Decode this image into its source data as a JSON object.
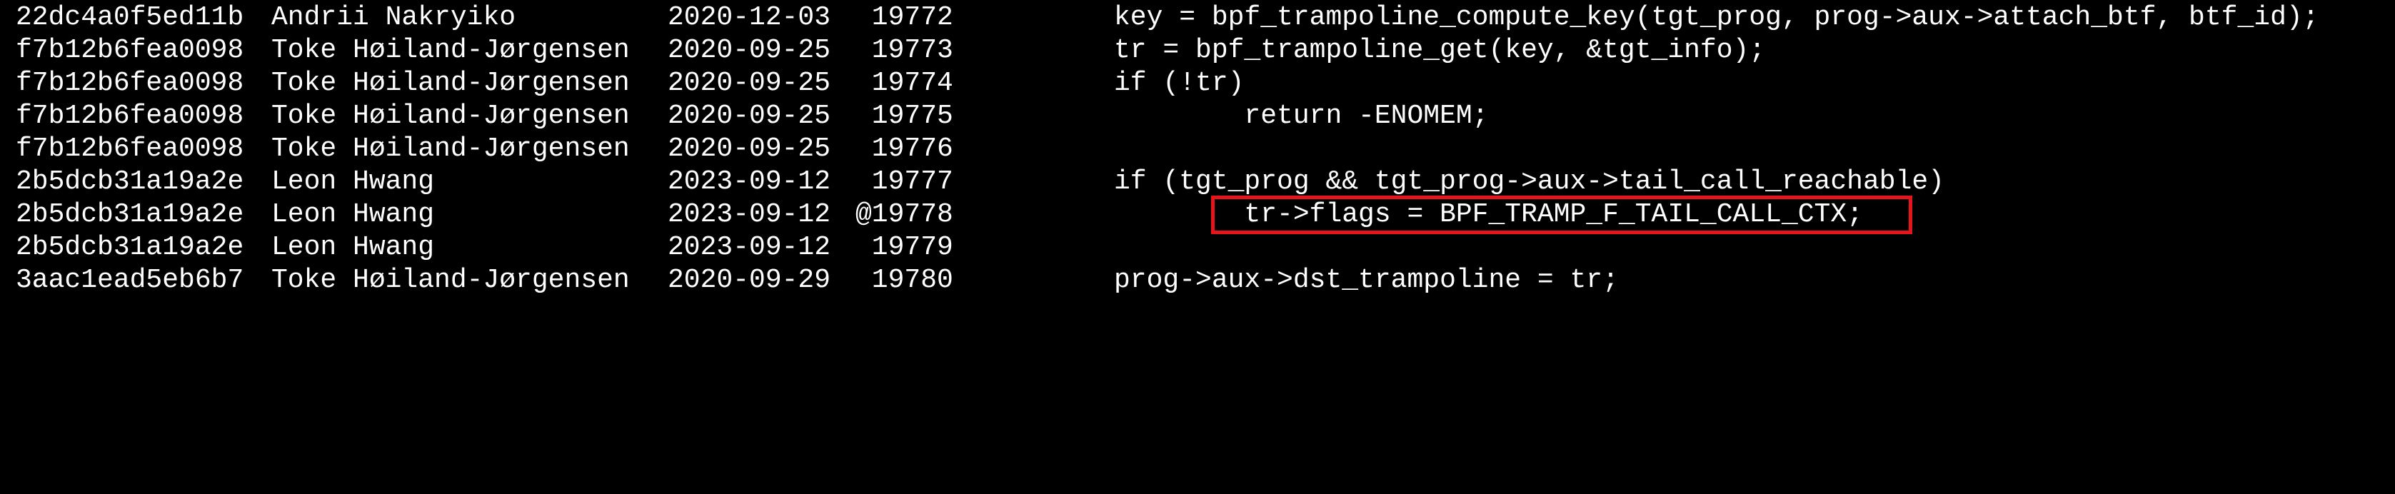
{
  "terminal": {
    "background": "#000000",
    "foreground": "#ffffff",
    "highlight_color": "#e8141b",
    "rows": [
      {
        "hash": "22dc4a0f5ed11b",
        "author": "Andrii Nakryiko",
        "date": "2020-12-03",
        "line": " 19772",
        "code": "key = bpf_trampoline_compute_key(tgt_prog, prog->aux->attach_btf, btf_id);"
      },
      {
        "hash": "f7b12b6fea0098",
        "author": "Toke Høiland-Jørgensen",
        "date": "2020-09-25",
        "line": " 19773",
        "code": "tr = bpf_trampoline_get(key, &tgt_info);"
      },
      {
        "hash": "f7b12b6fea0098",
        "author": "Toke Høiland-Jørgensen",
        "date": "2020-09-25",
        "line": " 19774",
        "code": "if (!tr)"
      },
      {
        "hash": "f7b12b6fea0098",
        "author": "Toke Høiland-Jørgensen",
        "date": "2020-09-25",
        "line": " 19775",
        "code": "        return -ENOMEM;"
      },
      {
        "hash": "f7b12b6fea0098",
        "author": "Toke Høiland-Jørgensen",
        "date": "2020-09-25",
        "line": " 19776",
        "code": ""
      },
      {
        "hash": "2b5dcb31a19a2e",
        "author": "Leon Hwang",
        "date": "2023-09-12",
        "line": " 19777",
        "code": "if (tgt_prog && tgt_prog->aux->tail_call_reachable)"
      },
      {
        "hash": "2b5dcb31a19a2e",
        "author": "Leon Hwang",
        "date": "2023-09-12",
        "line": "@19778",
        "code": "        tr->flags = BPF_TRAMP_F_TAIL_CALL_CTX;"
      },
      {
        "hash": "2b5dcb31a19a2e",
        "author": "Leon Hwang",
        "date": "2023-09-12",
        "line": " 19779",
        "code": ""
      },
      {
        "hash": "3aac1ead5eb6b7",
        "author": "Toke Høiland-Jørgensen",
        "date": "2020-09-29",
        "line": " 19780",
        "code": "prog->aux->dst_trampoline = tr;"
      }
    ]
  }
}
